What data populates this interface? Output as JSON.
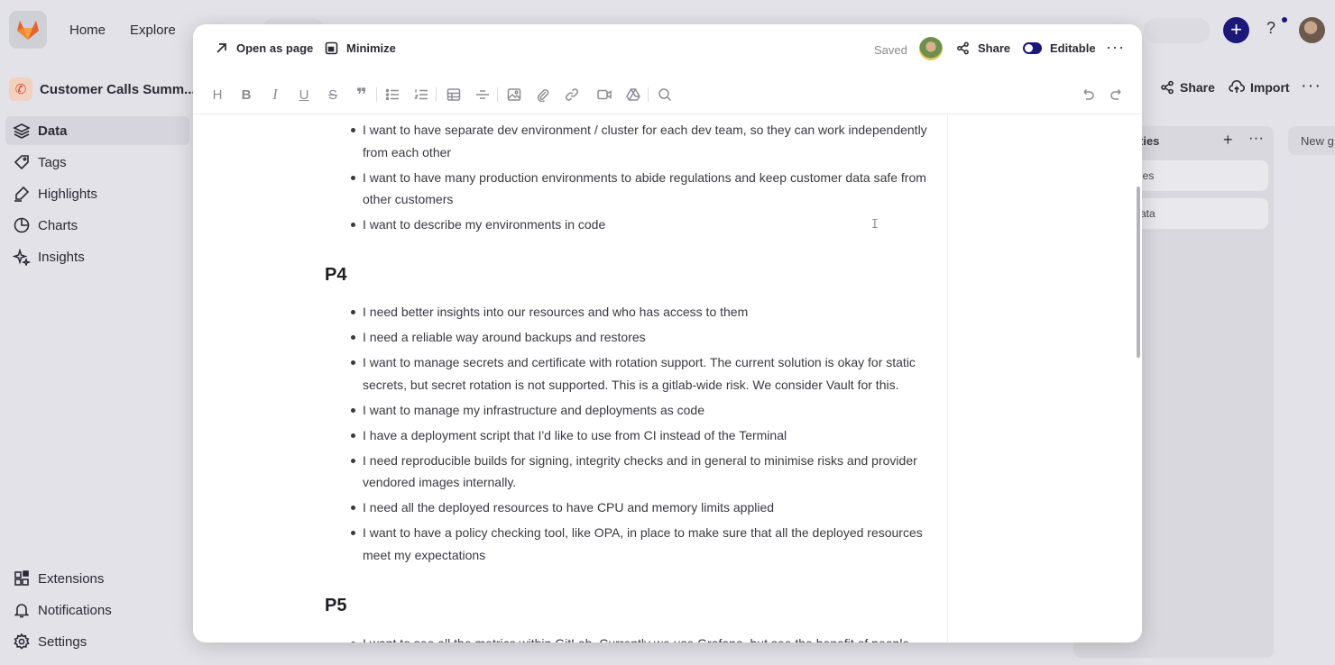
{
  "topbar": {
    "nav": [
      "Home",
      "Explore"
    ]
  },
  "sidebar": {
    "project_name": "Customer Calls Summ...",
    "items": [
      {
        "label": "Data",
        "icon": "layers-icon",
        "active": true
      },
      {
        "label": "Tags",
        "icon": "tag-icon"
      },
      {
        "label": "Highlights",
        "icon": "highlighter-icon"
      },
      {
        "label": "Charts",
        "icon": "pie-chart-icon"
      },
      {
        "label": "Insights",
        "icon": "sparkles-icon"
      }
    ],
    "bottom_items": [
      {
        "label": "Extensions",
        "icon": "extensions-icon"
      },
      {
        "label": "Notifications",
        "icon": "bell-icon"
      },
      {
        "label": "Settings",
        "icon": "gear-icon"
      }
    ]
  },
  "background_panel": {
    "share_label": "Share",
    "import_label": "Import",
    "column_title": "ties",
    "cards": [
      "ies",
      "ata"
    ],
    "new_column": "New g"
  },
  "modal": {
    "open_as_page": "Open as page",
    "minimize": "Minimize",
    "status": "Saved",
    "share": "Share",
    "editable": "Editable"
  },
  "document": {
    "top_bullets": [
      "I want to have separate dev environment / cluster for each dev team, so they can work independently from each other",
      "I want to have many production environments to abide regulations and keep customer data safe from other customers",
      "I want to describe my environments in code"
    ],
    "sections": [
      {
        "heading": "P4",
        "bullets": [
          "I need better insights into our resources and who has access to them",
          "I need a reliable way around backups and restores",
          "I want to manage secrets and certificate with rotation support. The current solution is okay for static secrets, but secret rotation is not supported. This is a gitlab-wide risk. We consider Vault for this.",
          "I want to manage my infrastructure and deployments as code",
          "I have a deployment script that I'd like to use from CI instead of the Terminal",
          "I need reproducible builds for signing, integrity checks and in general to minimise risks and provider vendored images internally.",
          "I need all the deployed resources to have CPU and memory limits applied",
          "I want to have a policy checking tool, like OPA, in place to make sure that all the deployed resources meet my expectations"
        ]
      },
      {
        "heading": "P5",
        "bullets": [
          "I want to see all the metrics within GitLab. Currently we use Grafana, but see the benefit of people"
        ]
      }
    ]
  }
}
